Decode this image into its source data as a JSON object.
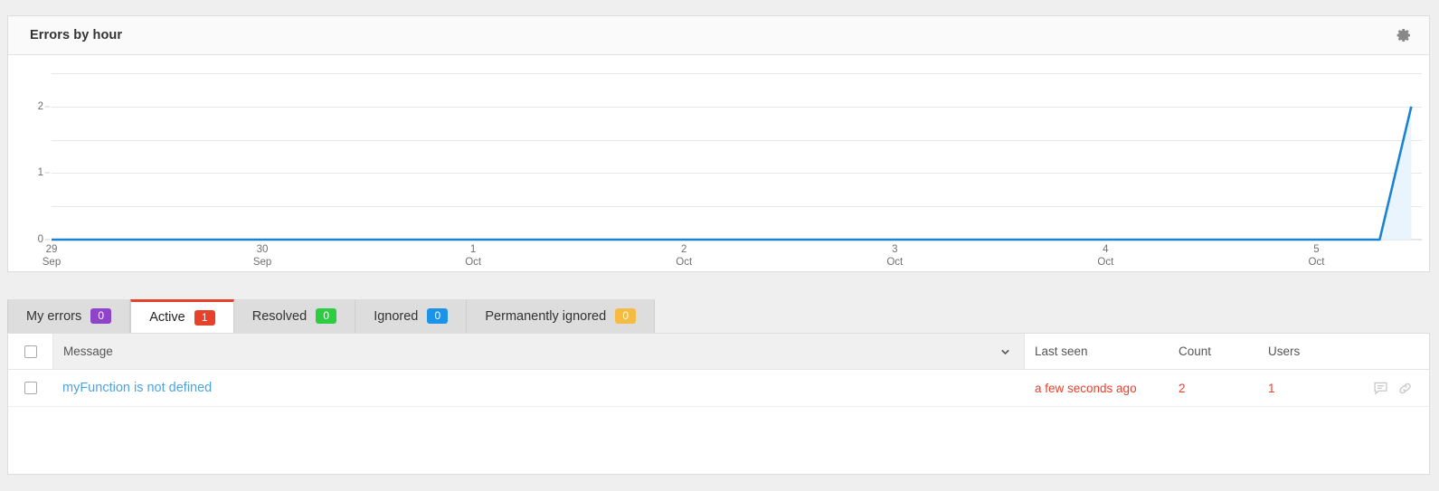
{
  "chart_panel": {
    "title": "Errors by hour",
    "settings_icon": "gear-icon"
  },
  "chart_data": {
    "type": "line",
    "title": "Errors by hour",
    "xlabel": "",
    "ylabel": "",
    "ylim": [
      0,
      2.5
    ],
    "yticks": [
      0,
      1,
      2
    ],
    "ytick_labels": [
      "0",
      "1",
      "2"
    ],
    "gridlines": [
      0,
      0.5,
      1,
      1.5,
      2,
      2.5
    ],
    "grid": true,
    "legend": "none",
    "line_color": "#1b82d2",
    "fill_color": "#eaf4fc",
    "categories": [
      "29 Sep",
      "30 Sep",
      "1 Oct",
      "2 Oct",
      "3 Oct",
      "4 Oct",
      "5 Oct"
    ],
    "xtick_labels": [
      {
        "day": "29",
        "month": "Sep"
      },
      {
        "day": "30",
        "month": "Sep"
      },
      {
        "day": "1",
        "month": "Oct"
      },
      {
        "day": "2",
        "month": "Oct"
      },
      {
        "day": "3",
        "month": "Oct"
      },
      {
        "day": "4",
        "month": "Oct"
      },
      {
        "day": "5",
        "month": "Oct"
      }
    ],
    "x": [
      0,
      0.5,
      1,
      1.5,
      2,
      2.5,
      3,
      3.5,
      4,
      4.5,
      5,
      5.5,
      6,
      6.3,
      6.45
    ],
    "values": [
      0,
      0,
      0,
      0,
      0,
      0,
      0,
      0,
      0,
      0,
      0,
      0,
      0,
      0,
      2
    ]
  },
  "tabs": [
    {
      "label": "My errors",
      "count": "0",
      "badge_color": "#8e44c8",
      "active": false
    },
    {
      "label": "Active",
      "count": "1",
      "badge_color": "#e8412b",
      "active": true
    },
    {
      "label": "Resolved",
      "count": "0",
      "badge_color": "#2ecc40",
      "active": false
    },
    {
      "label": "Ignored",
      "count": "0",
      "badge_color": "#1b93e8",
      "active": false
    },
    {
      "label": "Permanently ignored",
      "count": "0",
      "badge_color": "#f5bb42",
      "active": false
    }
  ],
  "table": {
    "columns": {
      "message": "Message",
      "last_seen": "Last seen",
      "count": "Count",
      "users": "Users"
    },
    "sort_icon": "chevron-down-icon",
    "rows": [
      {
        "message": "myFunction is not defined",
        "last_seen": "a few seconds ago",
        "count": "2",
        "users": "1",
        "actions": [
          "comment-icon",
          "link-icon"
        ]
      }
    ]
  }
}
